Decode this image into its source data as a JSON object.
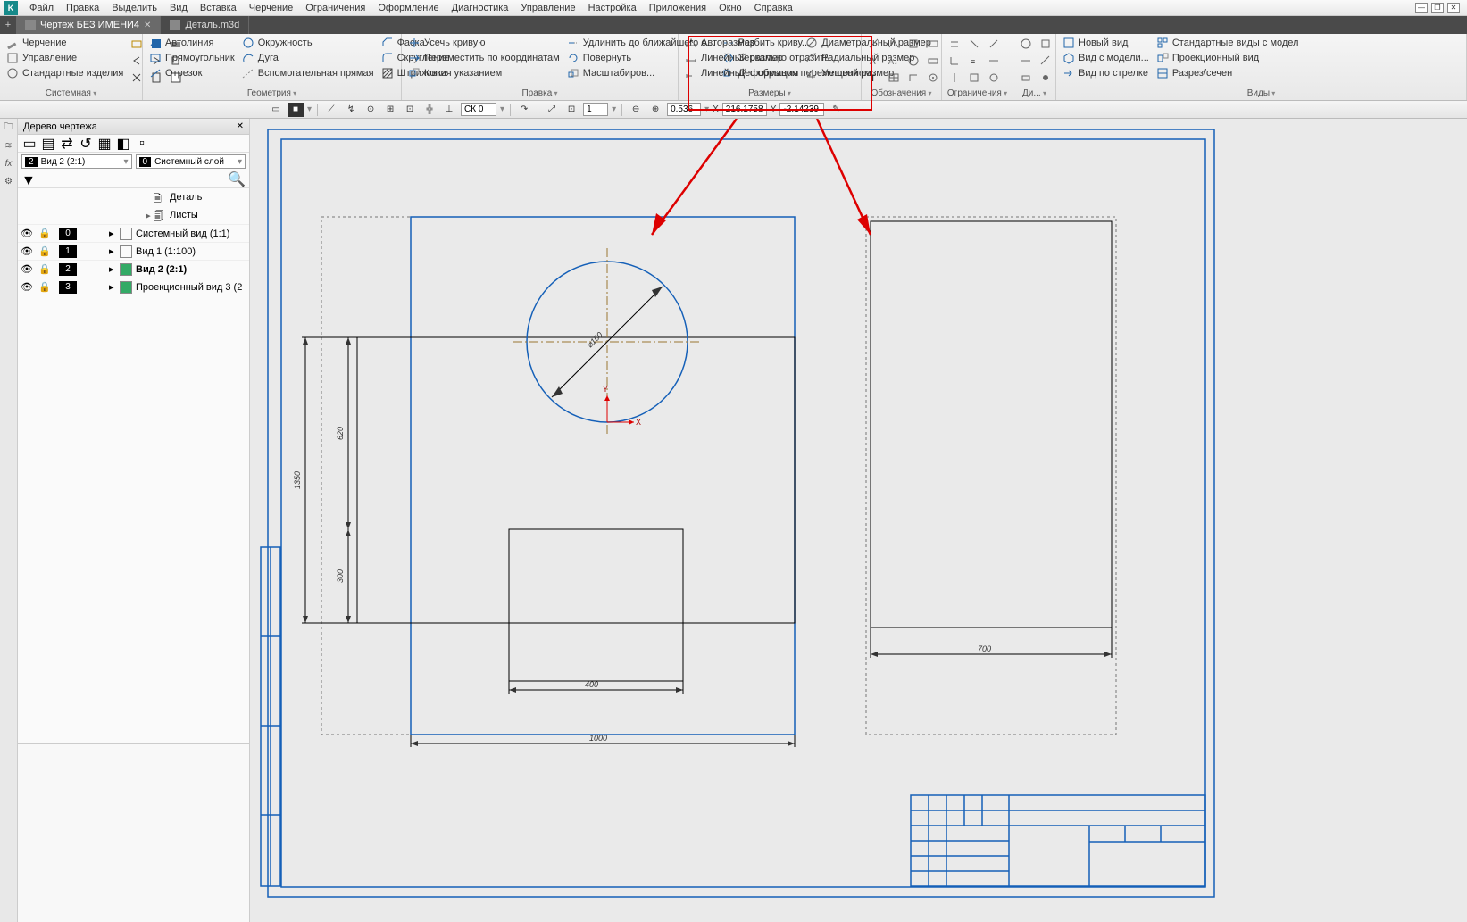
{
  "menu": {
    "items": [
      "Файл",
      "Правка",
      "Выделить",
      "Вид",
      "Вставка",
      "Черчение",
      "Ограничения",
      "Оформление",
      "Диагностика",
      "Управление",
      "Настройка",
      "Приложения",
      "Окно",
      "Справка"
    ]
  },
  "tabs": {
    "items": [
      {
        "label": "Чертеж БЕЗ ИМЕНИ4",
        "active": true
      },
      {
        "label": "Деталь.m3d",
        "active": false
      }
    ]
  },
  "ribbon": {
    "groups": {
      "system": {
        "title": "Системная",
        "items": [
          "Черчение",
          "Управление",
          "Стандартные изделия"
        ]
      },
      "geometry": {
        "title": "Геометрия",
        "items": [
          "Автолиния",
          "Прямоугольник",
          "Отрезок",
          "Окружность",
          "Дуга",
          "Вспомогательная прямая",
          "Фаска",
          "Скругление",
          "Штриховка"
        ]
      },
      "edit": {
        "title": "Правка",
        "items": [
          "Усечь кривую",
          "Переместить по координатам",
          "Копия указанием",
          "Удлинить до ближайшего о...",
          "Повернуть",
          "Масштабиров...",
          "Разбить криву...",
          "Зеркально отразить",
          "Деформация перемещением"
        ]
      },
      "dimensions": {
        "title": "Размеры",
        "items": [
          "Авторазмер",
          "Линейный размер",
          "Линейный с обрывом",
          "Диаметральный размер",
          "Радиальный размер",
          "Угловой размер"
        ]
      },
      "annotations": {
        "title": "Обозначения"
      },
      "constraints": {
        "title": "Ограничения"
      },
      "di": {
        "title": "Ди..."
      },
      "views": {
        "title": "Виды",
        "items": [
          "Новый вид",
          "Вид с модели...",
          "Вид по стрелке",
          "Стандартные виды с модел",
          "Проекционный вид",
          "Разрез/сечен"
        ]
      }
    }
  },
  "toolbar2": {
    "ck_label": "СК 0",
    "step": "1",
    "zoom": "0.536",
    "x_label": "X",
    "x_val": "216.1758",
    "y_label": "Y",
    "y_val": "-2.14239"
  },
  "tree": {
    "title": "Дерево чертежа",
    "view_combo": {
      "num": "2",
      "label": "Вид 2 (2:1)"
    },
    "layer_combo": {
      "num": "0",
      "label": "Системный слой"
    },
    "root": "Деталь",
    "sheets": "Листы",
    "rows": [
      {
        "num": "0",
        "label": "Системный вид (1:1)",
        "bold": false
      },
      {
        "num": "1",
        "label": "Вид 1 (1:100)",
        "bold": false
      },
      {
        "num": "2",
        "label": "Вид 2 (2:1)",
        "bold": true
      },
      {
        "num": "3",
        "label": "Проекционный вид 3 (2",
        "bold": false
      }
    ]
  },
  "drawing": {
    "dims": {
      "d1": "1350",
      "d2": "620",
      "d3": "300",
      "d4": "400",
      "d5": "1000",
      "d6": "700",
      "dia": "⌀160"
    },
    "axis": {
      "x": "X",
      "y": "Y"
    }
  }
}
